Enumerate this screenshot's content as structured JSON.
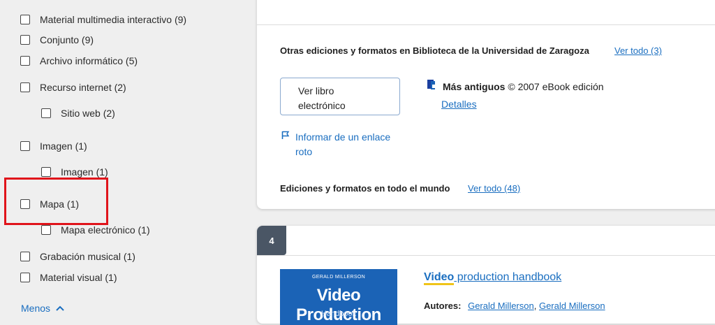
{
  "sidebar": {
    "facets": [
      {
        "label": "Material multimedia interactivo (9)"
      },
      {
        "label": "Conjunto (9)"
      },
      {
        "label": "Archivo informático (5)"
      },
      {
        "label": "Recurso internet (2)"
      },
      {
        "label": "Sitio web (2)"
      },
      {
        "label": "Imagen (1)"
      },
      {
        "label": "Imagen (1)"
      },
      {
        "label": "Mapa (1)"
      },
      {
        "label": "Mapa electrónico (1)"
      },
      {
        "label": "Grabación musical (1)"
      },
      {
        "label": "Material visual (1)"
      }
    ],
    "less_label": "Menos"
  },
  "editions": {
    "title": "Otras ediciones y formatos en Biblioteca de la Universidad de Zaragoza",
    "view_all": "Ver todo (3)",
    "ebook_button_line1": "Ver libro",
    "ebook_button_line2": "electrónico",
    "oldest_label": "Más antiguos",
    "oldest_detail": "© 2007 eBook edición",
    "details_link": "Detalles",
    "report_line1": "Informar de un enlace",
    "report_line2": "roto",
    "worldwide_label": "Ediciones y formatos en todo el mundo",
    "worldwide_view_all": "Ver todo (48)"
  },
  "result4": {
    "number": "4",
    "cover_author": "GERALD MILLERSON",
    "cover_title": "Video Production",
    "cover_sub": "Handbook",
    "title_highlight": "Video",
    "title_rest": " production handbook",
    "authors_label": "Autores:",
    "author1": "Gerald Millerson",
    "author2": "Gerald Millerson"
  },
  "colors": {
    "accent": "#1a6ec0",
    "highlight_box": "#e0141b",
    "badge": "#4a5665",
    "title_underline": "#f0c419"
  }
}
